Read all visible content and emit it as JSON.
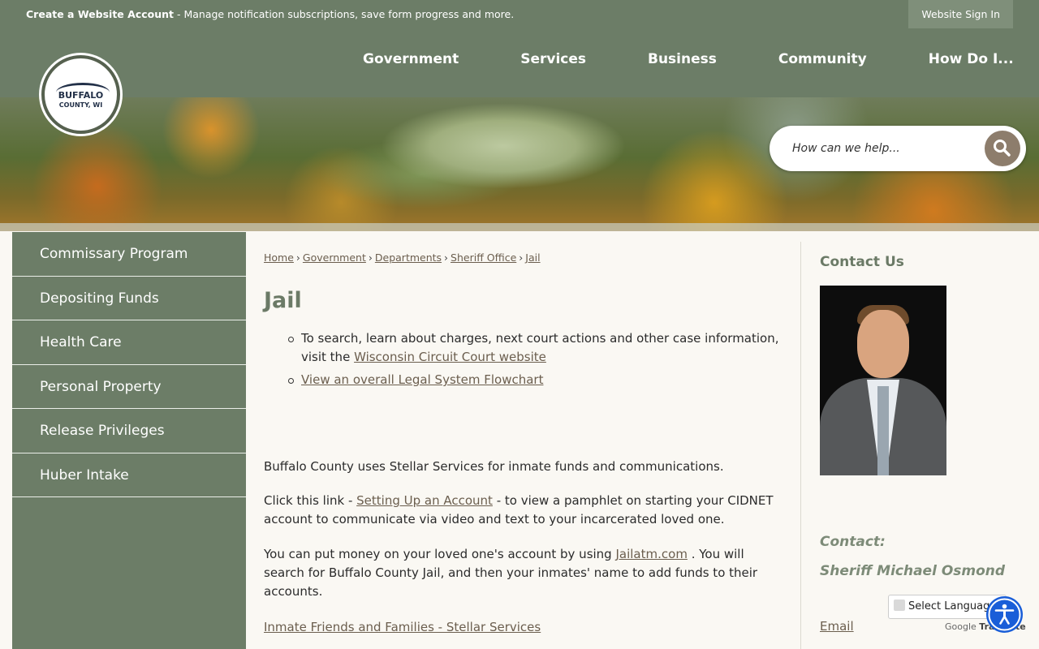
{
  "topbar": {
    "create_account_bold": "Create a Website Account",
    "create_account_text": " - Manage notification subscriptions, save form progress and more.",
    "sign_in": "Website Sign In"
  },
  "logo": {
    "line1": "BUFFALO",
    "line2": "COUNTY, WI"
  },
  "nav": [
    {
      "label": "Government"
    },
    {
      "label": "Services"
    },
    {
      "label": "Business"
    },
    {
      "label": "Community"
    },
    {
      "label": "How Do I..."
    }
  ],
  "search": {
    "placeholder": "How can we help..."
  },
  "sidebar": {
    "items": [
      {
        "label": "Commissary Program"
      },
      {
        "label": "Depositing Funds"
      },
      {
        "label": "Health Care"
      },
      {
        "label": "Personal Property"
      },
      {
        "label": "Release Privileges"
      },
      {
        "label": "Huber Intake"
      }
    ]
  },
  "breadcrumb": [
    "Home",
    "Government",
    "Departments",
    "Sheriff Office",
    "Jail"
  ],
  "main": {
    "title": "Jail",
    "bullet1_text": "To search, learn about charges, next court actions and other case information, visit the ",
    "bullet1_link": "Wisconsin Circuit Court website",
    "bullet2_link": "View an overall Legal System Flowchart",
    "p1": "Buffalo County uses Stellar Services for inmate funds and communications.",
    "p2_pre": "Click this link - ",
    "p2_link": "Setting Up an Account",
    "p2_post": " - to view a pamphlet on starting your CIDNET account to communicate via video and text to your incarcerated loved one.",
    "p3_pre": "You can put money on your loved one's account by using ",
    "p3_link": "Jailatm.com",
    "p3_post": " .  You will search for Buffalo County Jail, and then your inmates' name to add funds to their accounts.",
    "p4_link": "Inmate Friends and Families - Stellar Services"
  },
  "contact": {
    "title": "Contact Us",
    "label": "Contact:",
    "name": "Sheriff Michael Osmond",
    "email": "Email"
  },
  "translate": {
    "select": "Select Language",
    "powered_google": "Google",
    "powered_translate": "Translate"
  },
  "colors": {
    "header_green": "#6c7d67",
    "link_brown": "#6b5e4e",
    "search_button": "#8d7d6c",
    "accessibility_blue": "#1a5ed8"
  },
  "icons": {
    "search": "search-icon",
    "accessibility": "accessibility-icon",
    "translate": "google-translate-icon"
  }
}
